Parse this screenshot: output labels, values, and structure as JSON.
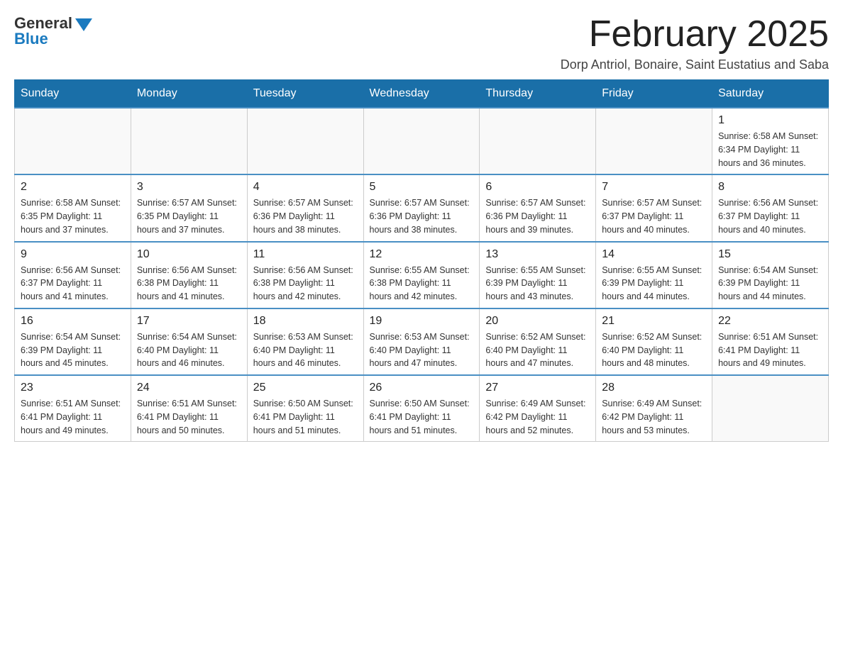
{
  "logo": {
    "general": "General",
    "blue": "Blue",
    "arrow": "▲"
  },
  "header": {
    "title": "February 2025",
    "subtitle": "Dorp Antriol, Bonaire, Saint Eustatius and Saba"
  },
  "weekdays": [
    "Sunday",
    "Monday",
    "Tuesday",
    "Wednesday",
    "Thursday",
    "Friday",
    "Saturday"
  ],
  "weeks": [
    [
      {
        "day": "",
        "info": ""
      },
      {
        "day": "",
        "info": ""
      },
      {
        "day": "",
        "info": ""
      },
      {
        "day": "",
        "info": ""
      },
      {
        "day": "",
        "info": ""
      },
      {
        "day": "",
        "info": ""
      },
      {
        "day": "1",
        "info": "Sunrise: 6:58 AM\nSunset: 6:34 PM\nDaylight: 11 hours and 36 minutes."
      }
    ],
    [
      {
        "day": "2",
        "info": "Sunrise: 6:58 AM\nSunset: 6:35 PM\nDaylight: 11 hours and 37 minutes."
      },
      {
        "day": "3",
        "info": "Sunrise: 6:57 AM\nSunset: 6:35 PM\nDaylight: 11 hours and 37 minutes."
      },
      {
        "day": "4",
        "info": "Sunrise: 6:57 AM\nSunset: 6:36 PM\nDaylight: 11 hours and 38 minutes."
      },
      {
        "day": "5",
        "info": "Sunrise: 6:57 AM\nSunset: 6:36 PM\nDaylight: 11 hours and 38 minutes."
      },
      {
        "day": "6",
        "info": "Sunrise: 6:57 AM\nSunset: 6:36 PM\nDaylight: 11 hours and 39 minutes."
      },
      {
        "day": "7",
        "info": "Sunrise: 6:57 AM\nSunset: 6:37 PM\nDaylight: 11 hours and 40 minutes."
      },
      {
        "day": "8",
        "info": "Sunrise: 6:56 AM\nSunset: 6:37 PM\nDaylight: 11 hours and 40 minutes."
      }
    ],
    [
      {
        "day": "9",
        "info": "Sunrise: 6:56 AM\nSunset: 6:37 PM\nDaylight: 11 hours and 41 minutes."
      },
      {
        "day": "10",
        "info": "Sunrise: 6:56 AM\nSunset: 6:38 PM\nDaylight: 11 hours and 41 minutes."
      },
      {
        "day": "11",
        "info": "Sunrise: 6:56 AM\nSunset: 6:38 PM\nDaylight: 11 hours and 42 minutes."
      },
      {
        "day": "12",
        "info": "Sunrise: 6:55 AM\nSunset: 6:38 PM\nDaylight: 11 hours and 42 minutes."
      },
      {
        "day": "13",
        "info": "Sunrise: 6:55 AM\nSunset: 6:39 PM\nDaylight: 11 hours and 43 minutes."
      },
      {
        "day": "14",
        "info": "Sunrise: 6:55 AM\nSunset: 6:39 PM\nDaylight: 11 hours and 44 minutes."
      },
      {
        "day": "15",
        "info": "Sunrise: 6:54 AM\nSunset: 6:39 PM\nDaylight: 11 hours and 44 minutes."
      }
    ],
    [
      {
        "day": "16",
        "info": "Sunrise: 6:54 AM\nSunset: 6:39 PM\nDaylight: 11 hours and 45 minutes."
      },
      {
        "day": "17",
        "info": "Sunrise: 6:54 AM\nSunset: 6:40 PM\nDaylight: 11 hours and 46 minutes."
      },
      {
        "day": "18",
        "info": "Sunrise: 6:53 AM\nSunset: 6:40 PM\nDaylight: 11 hours and 46 minutes."
      },
      {
        "day": "19",
        "info": "Sunrise: 6:53 AM\nSunset: 6:40 PM\nDaylight: 11 hours and 47 minutes."
      },
      {
        "day": "20",
        "info": "Sunrise: 6:52 AM\nSunset: 6:40 PM\nDaylight: 11 hours and 47 minutes."
      },
      {
        "day": "21",
        "info": "Sunrise: 6:52 AM\nSunset: 6:40 PM\nDaylight: 11 hours and 48 minutes."
      },
      {
        "day": "22",
        "info": "Sunrise: 6:51 AM\nSunset: 6:41 PM\nDaylight: 11 hours and 49 minutes."
      }
    ],
    [
      {
        "day": "23",
        "info": "Sunrise: 6:51 AM\nSunset: 6:41 PM\nDaylight: 11 hours and 49 minutes."
      },
      {
        "day": "24",
        "info": "Sunrise: 6:51 AM\nSunset: 6:41 PM\nDaylight: 11 hours and 50 minutes."
      },
      {
        "day": "25",
        "info": "Sunrise: 6:50 AM\nSunset: 6:41 PM\nDaylight: 11 hours and 51 minutes."
      },
      {
        "day": "26",
        "info": "Sunrise: 6:50 AM\nSunset: 6:41 PM\nDaylight: 11 hours and 51 minutes."
      },
      {
        "day": "27",
        "info": "Sunrise: 6:49 AM\nSunset: 6:42 PM\nDaylight: 11 hours and 52 minutes."
      },
      {
        "day": "28",
        "info": "Sunrise: 6:49 AM\nSunset: 6:42 PM\nDaylight: 11 hours and 53 minutes."
      },
      {
        "day": "",
        "info": ""
      }
    ]
  ]
}
